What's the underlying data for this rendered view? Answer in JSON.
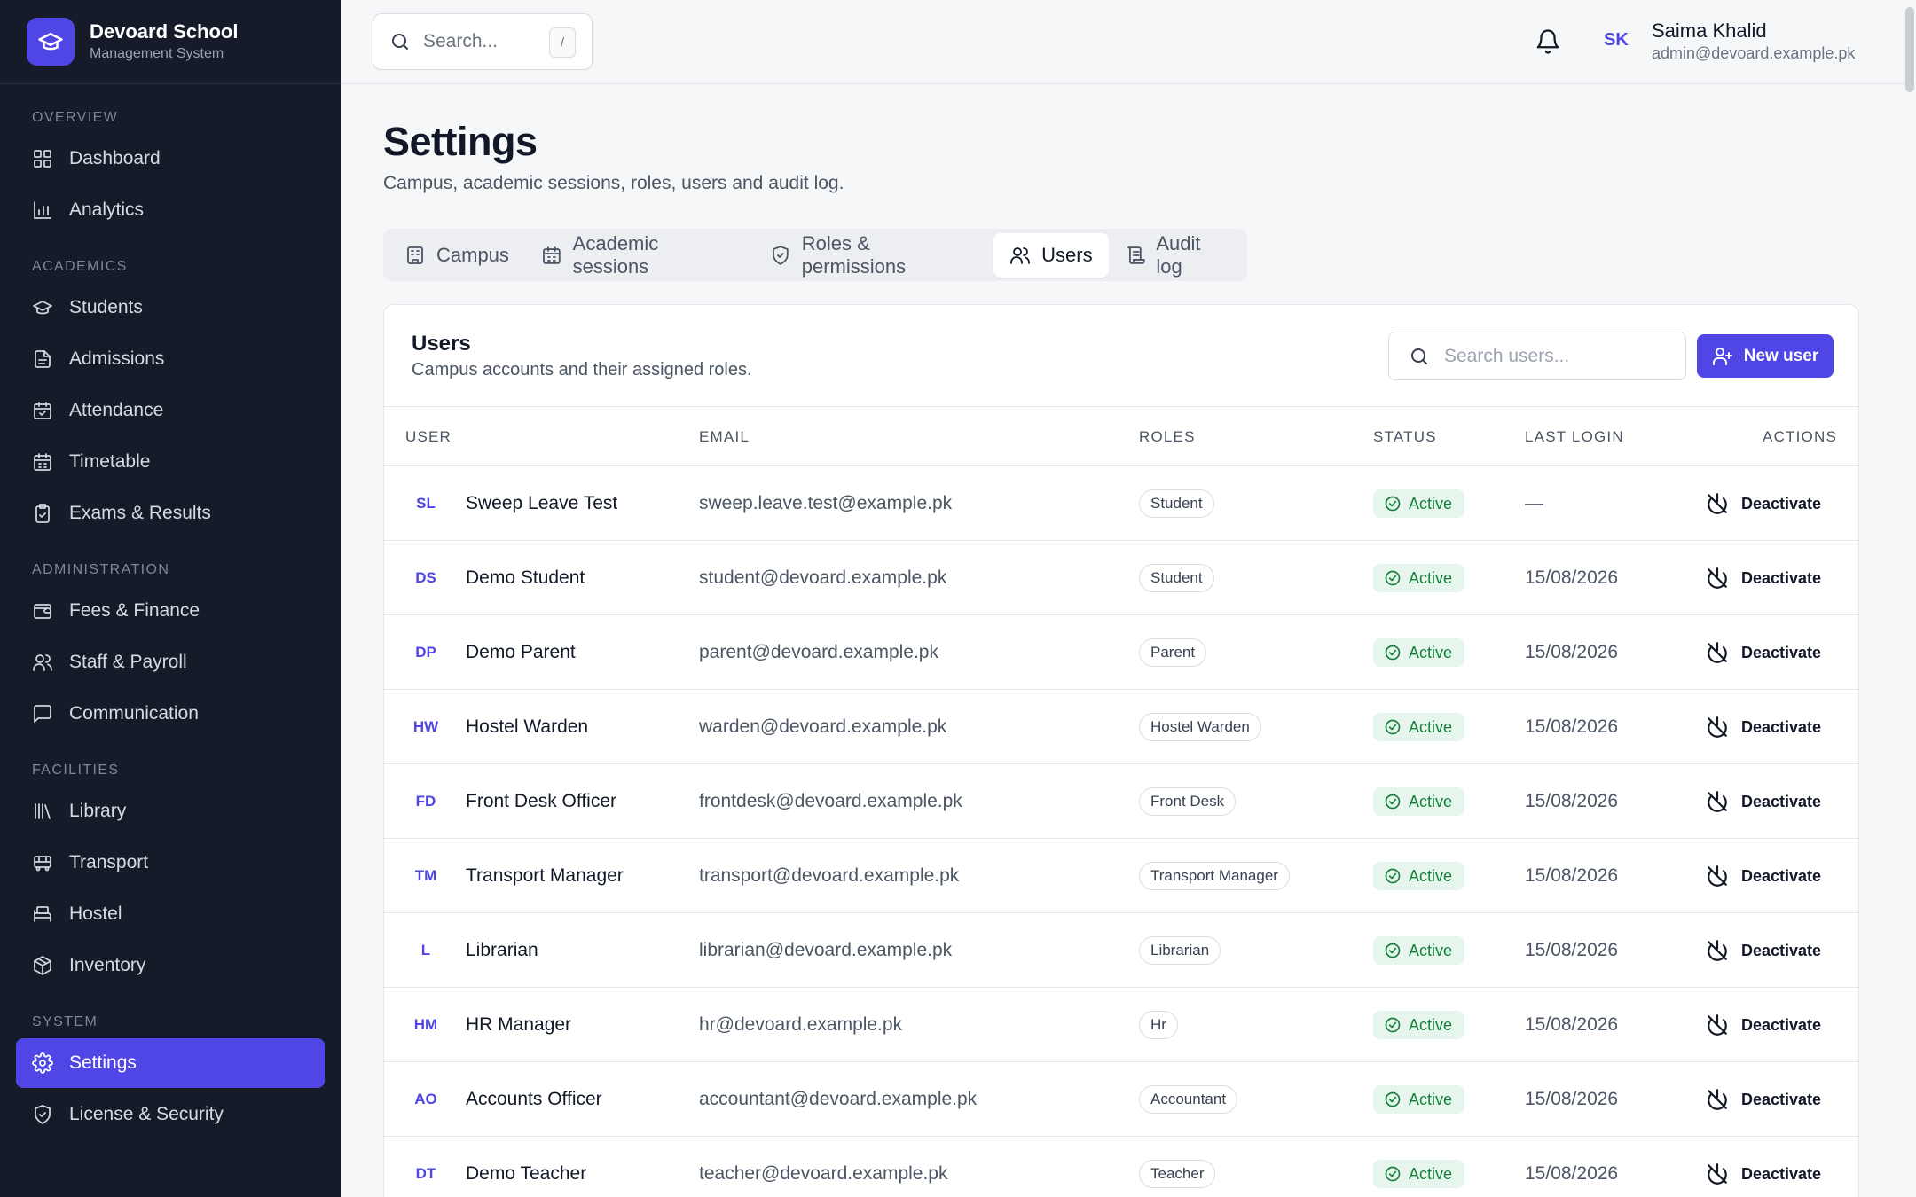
{
  "brand": {
    "name": "Devoard School",
    "subtitle": "Management System"
  },
  "sidebar": {
    "sections": [
      {
        "label": "OVERVIEW",
        "items": [
          {
            "label": "Dashboard",
            "icon": "grid-icon"
          },
          {
            "label": "Analytics",
            "icon": "bar-chart-icon"
          }
        ]
      },
      {
        "label": "ACADEMICS",
        "items": [
          {
            "label": "Students",
            "icon": "graduation-cap-icon"
          },
          {
            "label": "Admissions",
            "icon": "document-icon"
          },
          {
            "label": "Attendance",
            "icon": "calendar-check-icon"
          },
          {
            "label": "Timetable",
            "icon": "calendar-icon"
          },
          {
            "label": "Exams & Results",
            "icon": "clipboard-check-icon"
          }
        ]
      },
      {
        "label": "ADMINISTRATION",
        "items": [
          {
            "label": "Fees & Finance",
            "icon": "wallet-icon"
          },
          {
            "label": "Staff & Payroll",
            "icon": "users-icon"
          },
          {
            "label": "Communication",
            "icon": "message-icon"
          }
        ]
      },
      {
        "label": "FACILITIES",
        "items": [
          {
            "label": "Library",
            "icon": "library-icon"
          },
          {
            "label": "Transport",
            "icon": "bus-icon"
          },
          {
            "label": "Hostel",
            "icon": "bed-icon"
          },
          {
            "label": "Inventory",
            "icon": "package-icon"
          }
        ]
      },
      {
        "label": "SYSTEM",
        "items": [
          {
            "label": "Settings",
            "icon": "gear-icon",
            "active": true
          },
          {
            "label": "License & Security",
            "icon": "shield-icon"
          }
        ]
      }
    ]
  },
  "topbar": {
    "search_placeholder": "Search...",
    "shortcut": "/",
    "user": {
      "initials": "SK",
      "name": "Saima Khalid",
      "email": "admin@devoard.example.pk"
    }
  },
  "page": {
    "title": "Settings",
    "subtitle": "Campus, academic sessions, roles, users and audit log."
  },
  "tabs": [
    {
      "label": "Campus",
      "icon": "building-icon"
    },
    {
      "label": "Academic sessions",
      "icon": "calendar-icon"
    },
    {
      "label": "Roles & permissions",
      "icon": "shield-icon"
    },
    {
      "label": "Users",
      "icon": "users-icon",
      "active": true
    },
    {
      "label": "Audit log",
      "icon": "scroll-icon"
    }
  ],
  "users_card": {
    "title": "Users",
    "subtitle": "Campus accounts and their assigned roles.",
    "search_placeholder": "Search users...",
    "new_user_label": "New user",
    "columns": [
      "USER",
      "EMAIL",
      "ROLES",
      "STATUS",
      "LAST LOGIN",
      "ACTIONS"
    ],
    "rows": [
      {
        "initials": "SL",
        "name": "Sweep Leave Test",
        "email": "sweep.leave.test@example.pk",
        "role": "Student",
        "status": "Active",
        "last_login": "—",
        "action": "Deactivate"
      },
      {
        "initials": "DS",
        "name": "Demo Student",
        "email": "student@devoard.example.pk",
        "role": "Student",
        "status": "Active",
        "last_login": "15/08/2026",
        "action": "Deactivate"
      },
      {
        "initials": "DP",
        "name": "Demo Parent",
        "email": "parent@devoard.example.pk",
        "role": "Parent",
        "status": "Active",
        "last_login": "15/08/2026",
        "action": "Deactivate"
      },
      {
        "initials": "HW",
        "name": "Hostel Warden",
        "email": "warden@devoard.example.pk",
        "role": "Hostel Warden",
        "status": "Active",
        "last_login": "15/08/2026",
        "action": "Deactivate"
      },
      {
        "initials": "FD",
        "name": "Front Desk Officer",
        "email": "frontdesk@devoard.example.pk",
        "role": "Front Desk",
        "status": "Active",
        "last_login": "15/08/2026",
        "action": "Deactivate"
      },
      {
        "initials": "TM",
        "name": "Transport Manager",
        "email": "transport@devoard.example.pk",
        "role": "Transport Manager",
        "status": "Active",
        "last_login": "15/08/2026",
        "action": "Deactivate"
      },
      {
        "initials": "L",
        "name": "Librarian",
        "email": "librarian@devoard.example.pk",
        "role": "Librarian",
        "status": "Active",
        "last_login": "15/08/2026",
        "action": "Deactivate"
      },
      {
        "initials": "HM",
        "name": "HR Manager",
        "email": "hr@devoard.example.pk",
        "role": "Hr",
        "status": "Active",
        "last_login": "15/08/2026",
        "action": "Deactivate"
      },
      {
        "initials": "AO",
        "name": "Accounts Officer",
        "email": "accountant@devoard.example.pk",
        "role": "Accountant",
        "status": "Active",
        "last_login": "15/08/2026",
        "action": "Deactivate"
      },
      {
        "initials": "DT",
        "name": "Demo Teacher",
        "email": "teacher@devoard.example.pk",
        "role": "Teacher",
        "status": "Active",
        "last_login": "15/08/2026",
        "action": "Deactivate"
      }
    ]
  },
  "colors": {
    "accent": "#4f46e5",
    "sidebar_bg": "#151b28",
    "success_bg": "#e6f6ec",
    "success_text": "#16803c"
  }
}
